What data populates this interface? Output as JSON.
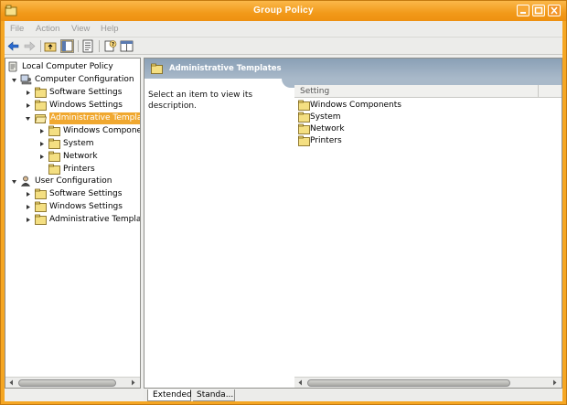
{
  "window": {
    "title": "Group Policy",
    "accent_color": "#f5a623",
    "controls": [
      "minimize-icon",
      "maximize-icon",
      "close-icon"
    ]
  },
  "menu": {
    "file": "File",
    "action": "Action",
    "view": "View",
    "help": "Help"
  },
  "toolbar": {
    "buttons": [
      "back-icon",
      "forward-icon",
      "up-folder-icon",
      "show-hide-tree-icon",
      "properties-icon",
      "help-icon",
      "show-hide-action-pane-icon"
    ]
  },
  "tree": {
    "items": [
      {
        "label": "Local Computer Policy"
      },
      {
        "label": "Computer Configuration"
      },
      {
        "label": "Software Settings"
      },
      {
        "label": "Windows Settings"
      },
      {
        "label": "Administrative Templat"
      },
      {
        "label": "Windows Componer"
      },
      {
        "label": "System"
      },
      {
        "label": "Network"
      },
      {
        "label": "Printers"
      },
      {
        "label": "User Configuration"
      },
      {
        "label": "Software Settings"
      },
      {
        "label": "Windows Settings"
      },
      {
        "label": "Administrative Templat"
      }
    ],
    "selected": "Administrative Templat"
  },
  "details": {
    "header_title": "Administrative Templates",
    "description": "Select an item to view its description.",
    "column_header": "Setting",
    "items": [
      {
        "label": "Windows Components"
      },
      {
        "label": "System"
      },
      {
        "label": "Network"
      },
      {
        "label": "Printers"
      }
    ]
  },
  "bottom_tabs": {
    "extended": "Extended",
    "standard": "Standa..."
  }
}
